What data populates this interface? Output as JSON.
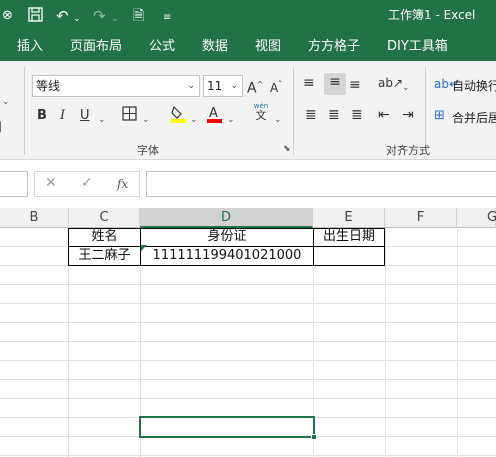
{
  "titlebar": {
    "autosave_icon": "autosave-toggle-icon",
    "save_icon": "save-icon",
    "undo_icon": "undo-icon",
    "redo_icon": "redo-icon",
    "print_preview_icon": "print-preview-icon",
    "customize_icon": "customize-qat-icon",
    "title": "工作簿1  -  Excel"
  },
  "tabs": [
    "插入",
    "页面布局",
    "公式",
    "数据",
    "视图",
    "方方格子",
    "DIY工具箱"
  ],
  "ribbon": {
    "font_name": "等线",
    "font_size": "11",
    "increase_font_label": "A",
    "decrease_font_label": "A",
    "bold_label": "B",
    "italic_label": "I",
    "underline_label": "U",
    "phonetic_top": "wén",
    "phonetic_bottom": "文",
    "font_group_label": "字体",
    "wrap_text_label": "自动换行",
    "merge_center_label": "合并后居",
    "alignment_group_label": "对齐方式",
    "fill_color": "#ffff00",
    "font_color": "#ff0000"
  },
  "formula_bar": {
    "cancel_glyph": "✕",
    "enter_glyph": "✓",
    "function_label": "fx",
    "value": ""
  },
  "columns": [
    "B",
    "C",
    "D",
    "E",
    "F",
    "G"
  ],
  "selected_column": "D",
  "cells": {
    "C1": "姓名",
    "D1": "身份证",
    "E1": "出生日期",
    "C2": "王二麻子",
    "D2": "111111199401021000",
    "E2": ""
  },
  "colors": {
    "accent": "#217346"
  }
}
